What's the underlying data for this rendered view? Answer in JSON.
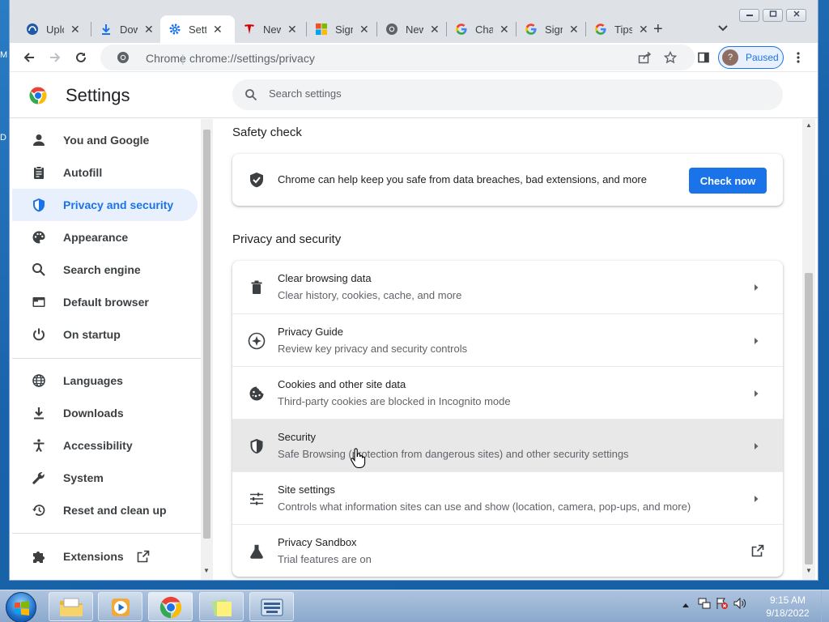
{
  "desktop": {
    "fragment_1": "M",
    "fragment_2": "D"
  },
  "tabs": [
    {
      "title": "Uplo"
    },
    {
      "title": "Dow"
    },
    {
      "title": "Setti"
    },
    {
      "title": "New"
    },
    {
      "title": "Sign"
    },
    {
      "title": "New"
    },
    {
      "title": "Cha"
    },
    {
      "title": "Sign"
    },
    {
      "title": "Tips"
    }
  ],
  "tab_close_glyph": "✕",
  "new_tab_glyph": "+",
  "toolbar": {
    "site_label": "Chrome",
    "separator": "|",
    "url": "chrome://settings/privacy",
    "profile_initial": "?",
    "profile_status": "Paused"
  },
  "settings": {
    "title": "Settings",
    "search_placeholder": "Search settings"
  },
  "sidebar": {
    "items": [
      {
        "label": "You and Google",
        "icon": "person-icon"
      },
      {
        "label": "Autofill",
        "icon": "clipboard-icon"
      },
      {
        "label": "Privacy and security",
        "icon": "shield-icon",
        "active": true
      },
      {
        "label": "Appearance",
        "icon": "palette-icon"
      },
      {
        "label": "Search engine",
        "icon": "search-icon"
      },
      {
        "label": "Default browser",
        "icon": "browser-icon"
      },
      {
        "label": "On startup",
        "icon": "power-icon"
      },
      {
        "label": "Languages",
        "icon": "globe-icon"
      },
      {
        "label": "Downloads",
        "icon": "download-icon"
      },
      {
        "label": "Accessibility",
        "icon": "accessibility-icon"
      },
      {
        "label": "System",
        "icon": "wrench-icon"
      },
      {
        "label": "Reset and clean up",
        "icon": "history-icon"
      },
      {
        "label": "Extensions",
        "icon": "puzzle-icon"
      }
    ]
  },
  "safety_check": {
    "heading": "Safety check",
    "text": "Chrome can help keep you safe from data breaches, bad extensions, and more",
    "button": "Check now"
  },
  "privacy": {
    "heading": "Privacy and security",
    "rows": [
      {
        "title": "Clear browsing data",
        "subtitle": "Clear history, cookies, cache, and more",
        "icon": "trash-icon"
      },
      {
        "title": "Privacy Guide",
        "subtitle": "Review key privacy and security controls",
        "icon": "compass-icon"
      },
      {
        "title": "Cookies and other site data",
        "subtitle": "Third-party cookies are blocked in Incognito mode",
        "icon": "cookie-icon"
      },
      {
        "title": "Security",
        "subtitle": "Safe Browsing (protection from dangerous sites) and other security settings",
        "icon": "shield-half-icon"
      },
      {
        "title": "Site settings",
        "subtitle": "Controls what information sites can use and show (location, camera, pop-ups, and more)",
        "icon": "sliders-icon"
      },
      {
        "title": "Privacy Sandbox",
        "subtitle": "Trial features are on",
        "icon": "flask-icon"
      }
    ]
  },
  "taskbar": {
    "time": "9:15 AM",
    "date": "9/18/2022"
  },
  "colors": {
    "accent": "#1a73e8",
    "active_nav_bg": "#e8f0fe",
    "hover_row_bg": "#e8e8e9"
  }
}
